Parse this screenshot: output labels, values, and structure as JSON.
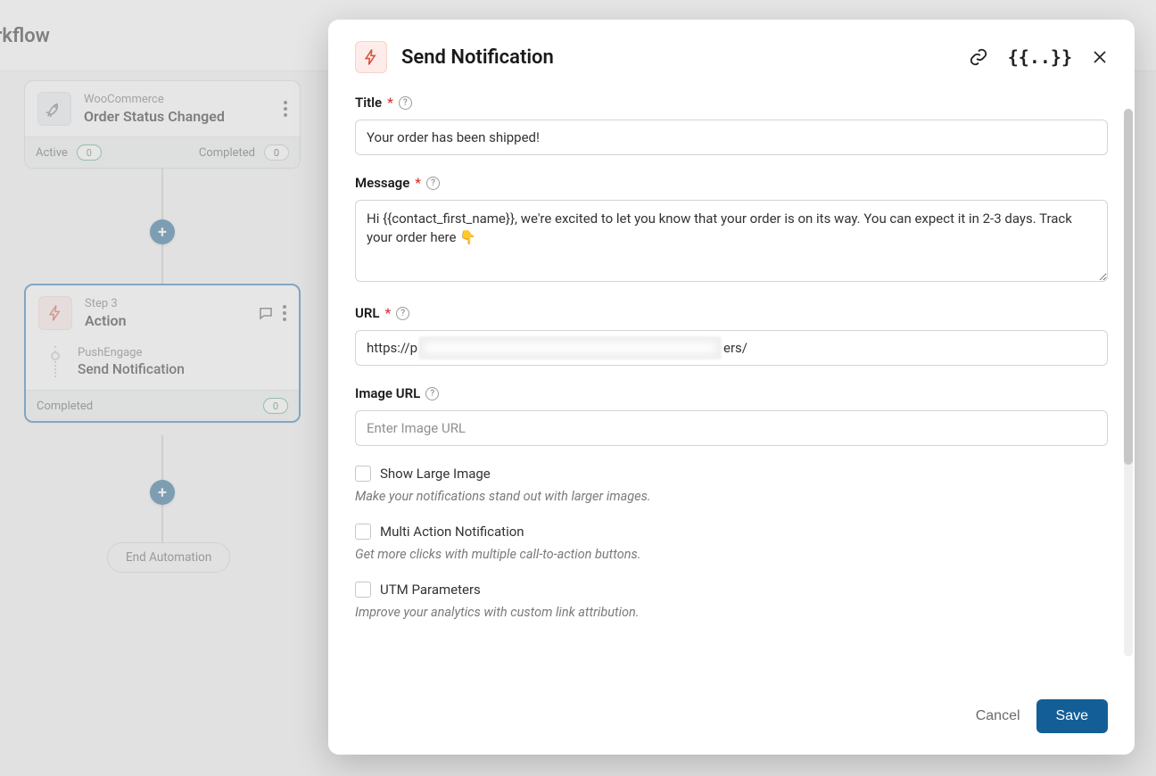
{
  "page_header": "orkflow",
  "workflow": {
    "trigger": {
      "sup": "WooCommerce",
      "title": "Order Status Changed",
      "status_left": "Active",
      "status_left_count": "0",
      "status_right": "Completed",
      "status_right_count": "0"
    },
    "action": {
      "sup": "Step 3",
      "title": "Action",
      "sub_provider": "PushEngage",
      "sub_name": "Send Notification",
      "status_left": "Completed",
      "status_left_count": "0"
    },
    "end_label": "End Automation"
  },
  "modal": {
    "title": "Send Notification",
    "fields": {
      "title": {
        "label": "Title",
        "value": "Your order has been shipped!"
      },
      "message": {
        "label": "Message",
        "value": "Hi {{contact_first_name}}, we're excited to let you know that your order is on its way. You can expect it in 2-3 days. Track your order here 👇"
      },
      "url": {
        "label": "URL",
        "value_prefix": "https://p",
        "value_suffix": "ers/"
      },
      "image_url": {
        "label": "Image URL",
        "placeholder": "Enter Image URL"
      },
      "show_large_image": {
        "label": "Show Large Image",
        "desc": "Make your notifications stand out with larger images."
      },
      "multi_action": {
        "label": "Multi Action Notification",
        "desc": "Get more clicks with multiple call-to-action buttons."
      },
      "utm": {
        "label": "UTM Parameters",
        "desc": "Improve your analytics with custom link attribution."
      }
    },
    "footer": {
      "cancel": "Cancel",
      "save": "Save"
    }
  }
}
